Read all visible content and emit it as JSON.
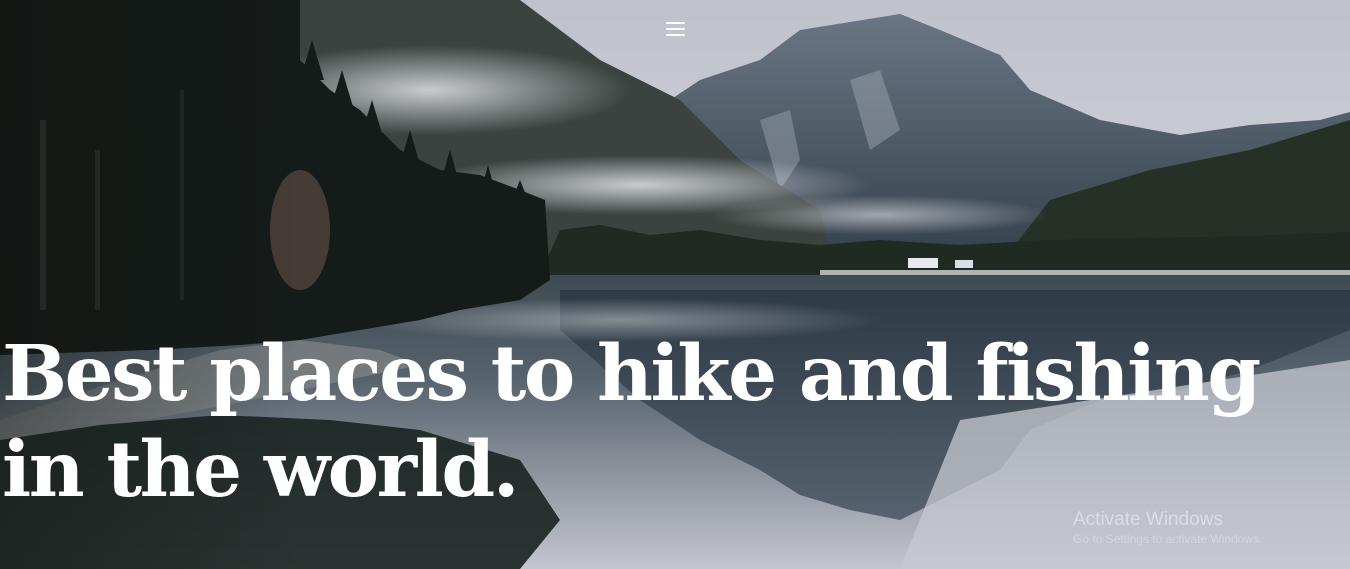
{
  "nav": {
    "menu_icon": "hamburger-menu-icon"
  },
  "hero": {
    "headline_line1": "Best places to hike and fishing",
    "headline_line2": "in the world.",
    "background": "mountain-lake-forest-photo"
  },
  "system_overlay": {
    "title": "Activate Windows",
    "subtitle": "Go to Settings to activate Windows."
  },
  "colors": {
    "text": "#ffffff",
    "sky": "#c9ccd3",
    "water": "#b9bdc6",
    "forest": "#1d2622"
  }
}
